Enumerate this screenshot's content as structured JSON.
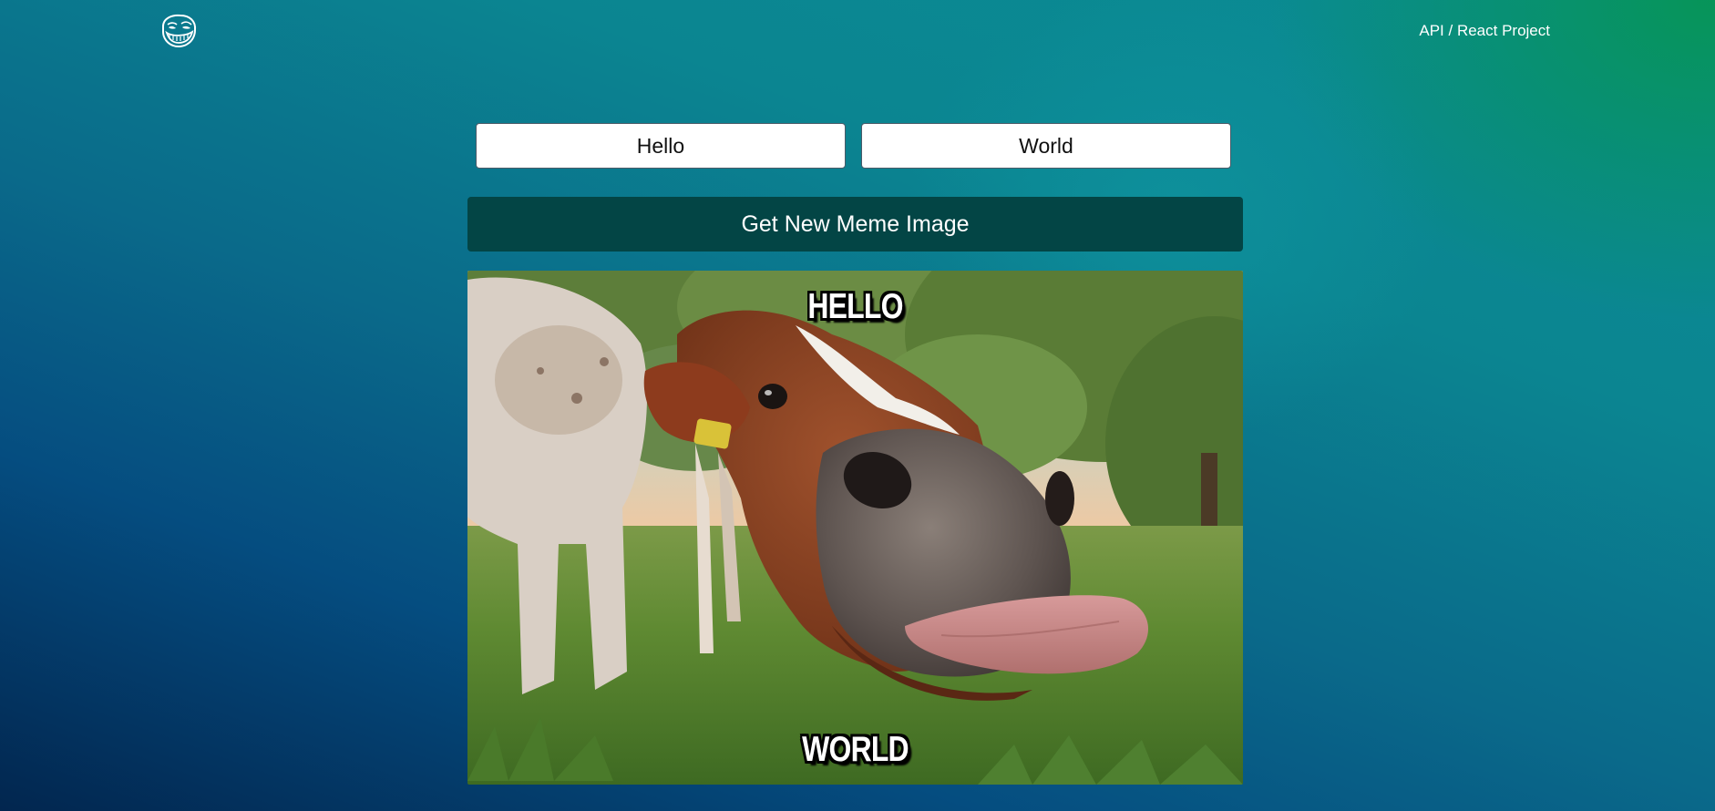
{
  "header": {
    "logo_icon": "troll-face-icon",
    "project_title": "API / React Project"
  },
  "form": {
    "top_text": "Hello",
    "bottom_text": "World",
    "button_label": "Get New Meme Image"
  },
  "meme": {
    "image_subject": "cow-sticking-out-tongue",
    "top_text": "HELLO",
    "bottom_text": "WORLD"
  },
  "colors": {
    "button_bg": "#034545",
    "gradient_top": "#0a8d93",
    "gradient_green": "#06964e",
    "gradient_bottom": "#02264f"
  }
}
